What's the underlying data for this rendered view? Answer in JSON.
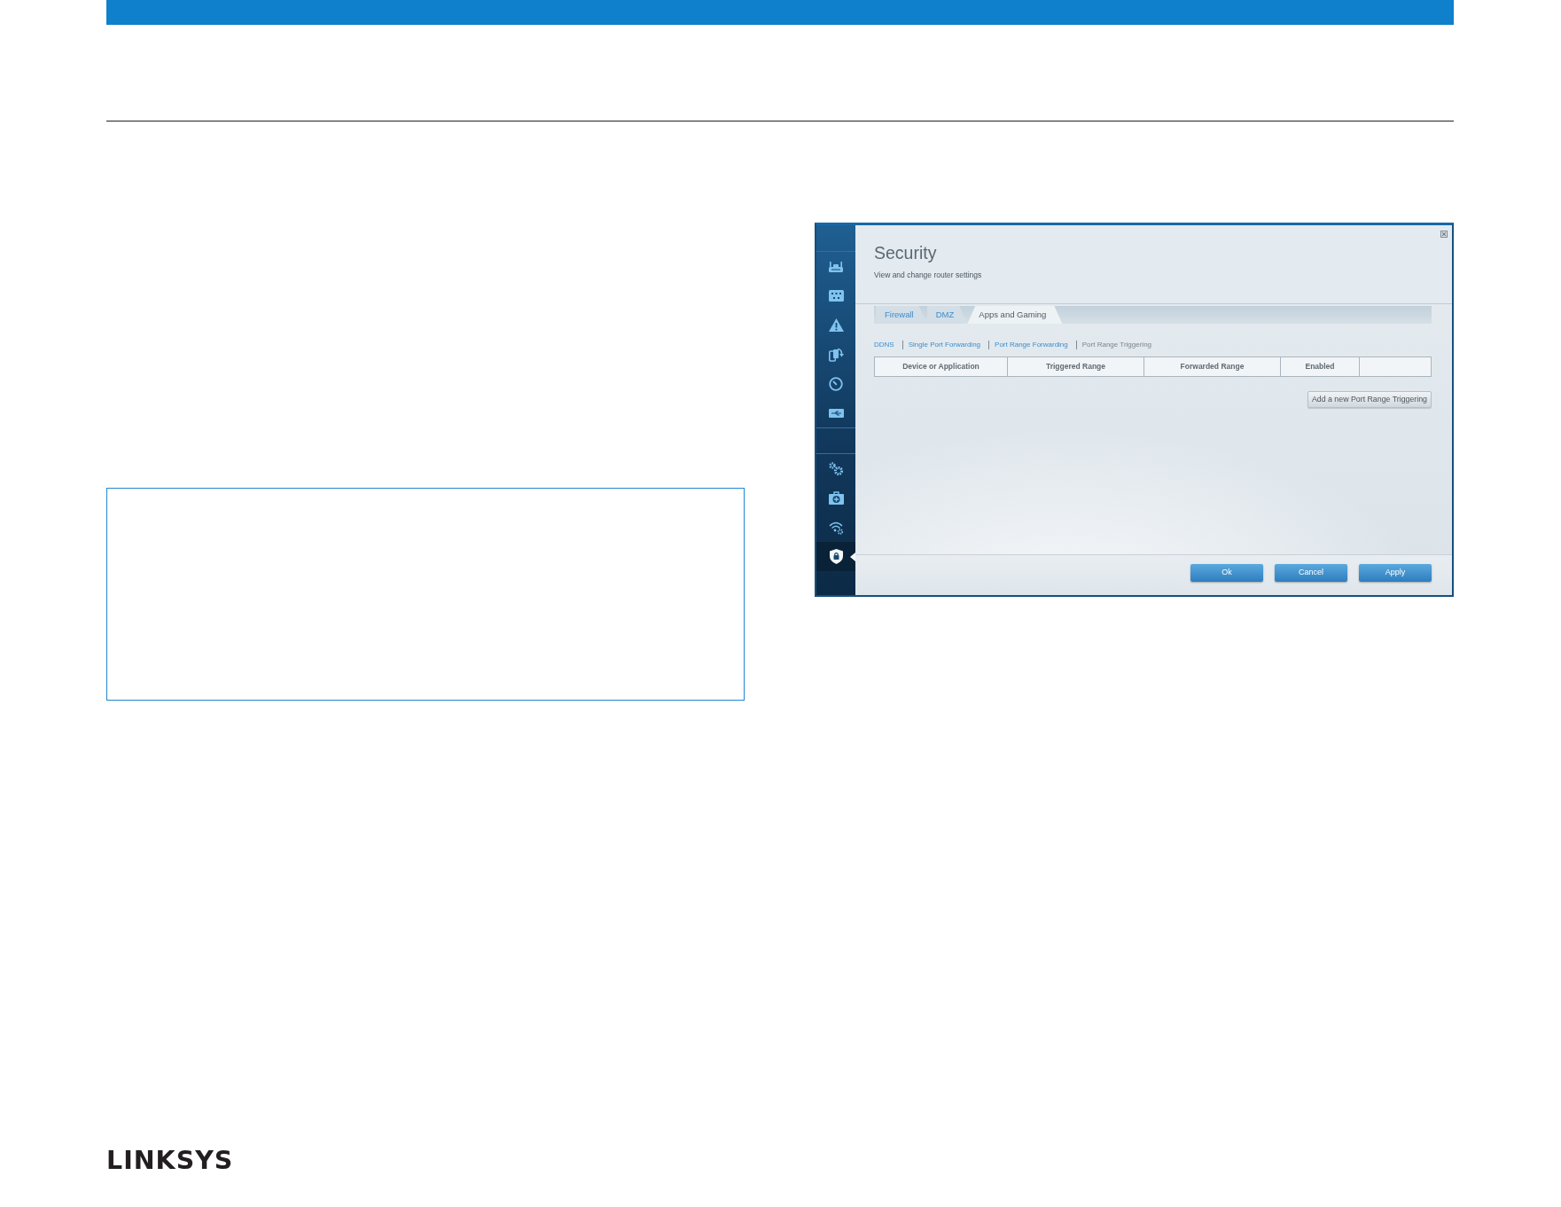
{
  "screenshot": {
    "sidebar": {
      "groups": [
        {
          "items": [
            {
              "selected": false
            },
            {
              "selected": false
            },
            {
              "selected": false
            },
            {
              "selected": false
            },
            {
              "selected": false
            },
            {
              "selected": false
            }
          ]
        },
        {
          "items": [
            {
              "selected": false
            },
            {
              "selected": false
            },
            {
              "selected": false
            },
            {
              "selected": true
            }
          ]
        }
      ]
    },
    "header": {
      "title": "Security",
      "subtitle": "View and change router settings"
    },
    "tabs": [
      {
        "label": "Firewall",
        "selected": false
      },
      {
        "label": "DMZ",
        "selected": false
      },
      {
        "label": "Apps and Gaming",
        "selected": true
      }
    ],
    "sub_navigation": [
      {
        "label": "DDNS",
        "selected": false
      },
      {
        "label": "Single Port Forwarding",
        "selected": false
      },
      {
        "label": "Port Range Forwarding",
        "selected": false
      },
      {
        "label": "Port Range Triggering",
        "selected": true
      }
    ],
    "table": {
      "columns": [
        {
          "kind": "heading",
          "label": "Device or Application"
        },
        {
          "kind": "heading",
          "label": "Triggered Range"
        },
        {
          "kind": "heading",
          "label": "Forwarded Range"
        },
        {
          "kind": "heading",
          "label": "Enabled"
        },
        {
          "kind": "blank"
        }
      ]
    },
    "add_button": "Add a new Port Range Triggering",
    "buttons": [
      "Ok",
      "Cancel",
      "Apply"
    ]
  },
  "footer": {
    "logo": "LINKSYS"
  }
}
